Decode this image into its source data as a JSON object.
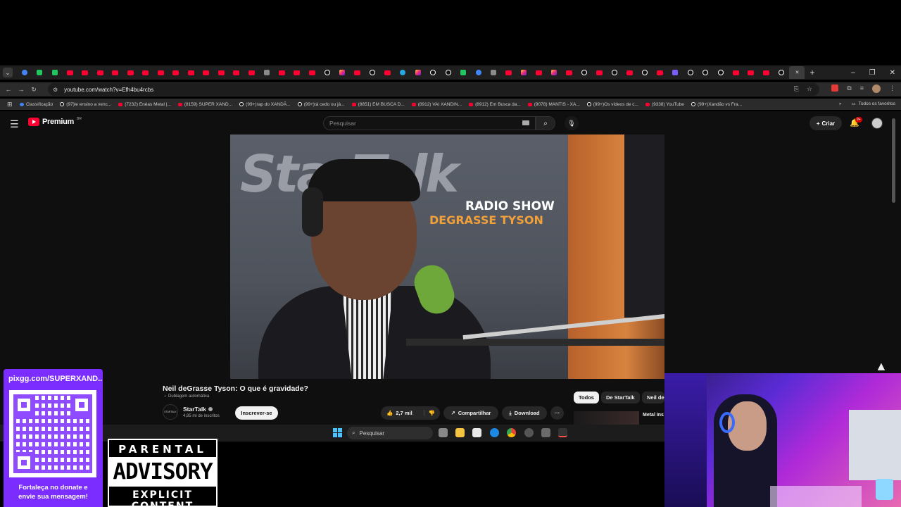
{
  "browser": {
    "tab_favicons": [
      "gl",
      "gr",
      "gr",
      "yt",
      "yt",
      "yt",
      "yt",
      "yt",
      "yt",
      "yt",
      "yt",
      "yt",
      "yt",
      "yt",
      "yt",
      "yt",
      "gy",
      "yt",
      "yt",
      "yt",
      "tt",
      "ig",
      "yt",
      "tt",
      "yt",
      "bl",
      "ig",
      "tt",
      "tt",
      "gr",
      "gl",
      "gy",
      "yt",
      "ig",
      "yt",
      "ig",
      "yt",
      "tt",
      "yt",
      "tt",
      "yt",
      "tt",
      "yt",
      "pu",
      "tt",
      "tt",
      "tt",
      "yt",
      "yt",
      "yt",
      "tt",
      "tt"
    ],
    "new_tab": "+",
    "window_controls": {
      "minimize": "–",
      "maximize": "❐",
      "close": "✕"
    },
    "url": "youtube.com/watch?v=Efh4bu4rcbs",
    "bookmarks": [
      {
        "label": "Classificação",
        "icon": "gl"
      },
      {
        "label": "(97)le ensino a venc...",
        "icon": "tt"
      },
      {
        "label": "(7232) Enéas Metal |...",
        "icon": "yt"
      },
      {
        "label": "(8159) SUPER XAND...",
        "icon": "yt"
      },
      {
        "label": "(99+)rap do XANDÃ...",
        "icon": "tt"
      },
      {
        "label": "(99+)tá cedo ou já...",
        "icon": "tt"
      },
      {
        "label": "(8851) EM BUSCA D...",
        "icon": "yt"
      },
      {
        "label": "(8912) VAI XANDIN...",
        "icon": "yt"
      },
      {
        "label": "(8912) Em Busca da...",
        "icon": "yt"
      },
      {
        "label": "(9078) MANTIS - XA...",
        "icon": "yt"
      },
      {
        "label": "(99+)Os vídeos de c...",
        "icon": "tt"
      },
      {
        "label": "(9338) YouTube",
        "icon": "yt"
      },
      {
        "label": "(99+)Xandão vs Fra...",
        "icon": "tt"
      }
    ],
    "bookmarks_more": "»",
    "all_bookmarks": "Todos os favoritos"
  },
  "youtube": {
    "logo": "Premium",
    "region": "BR",
    "search_placeholder": "Pesquisar",
    "create_label": "Criar",
    "notification_count": "9+",
    "video": {
      "overlay_brand": "StarTalk",
      "overlay_line1": "RADIO SHOW",
      "overlay_line2": "DEGRASSE TYSON"
    },
    "title": "Neil deGrasse Tyson: O que é gravidade?",
    "dubbing": "Dublagem automática",
    "channel": {
      "name": "StarTalk",
      "subs": "4,85 mi de inscritos",
      "avatar_text": "STARTALK"
    },
    "subscribe_label": "Inscrever-se",
    "likes": "2,7 mil",
    "share_label": "Compartilhar",
    "download_label": "Download",
    "more_label": "···",
    "chips": [
      "Todos",
      "De StarTalk",
      "Neil de"
    ],
    "rec_title": "Metal Ins"
  },
  "taskbar": {
    "search_placeholder": "Pesquisar"
  },
  "overlay": {
    "qr_url": "pixgg.com/SUPERXAND...",
    "qr_message_line1": "Fortaleça no donate e",
    "qr_message_line2": "envie sua mensagem!",
    "advisory_top": "PARENTAL",
    "advisory_mid": "ADVISORY",
    "advisory_bot": "EXPLICIT CONTENT"
  }
}
